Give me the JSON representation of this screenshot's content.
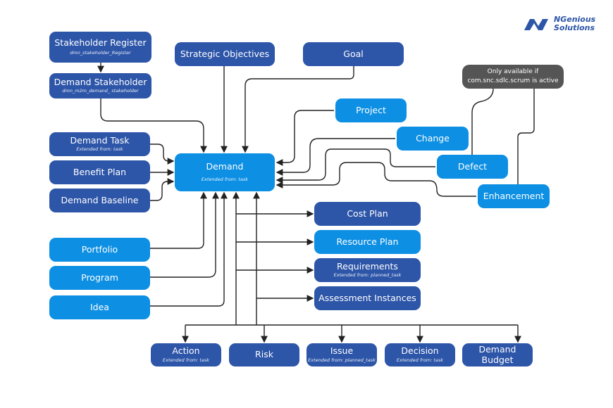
{
  "logo": {
    "line1": "NGenious",
    "line2": "Solutions"
  },
  "note": {
    "text": "Only available if com.snc.sdlc.scrum is active"
  },
  "nodes": {
    "stakeholder_register": {
      "title": "Stakeholder Register",
      "sub": "dmn_stakeholder_Register"
    },
    "demand_stakeholder": {
      "title": "Demand Stakeholder",
      "sub": "dmn_m2m_demand_ stakeholder"
    },
    "strategic_objectives": {
      "title": "Strategic Objectives"
    },
    "goal": {
      "title": "Goal"
    },
    "project": {
      "title": "Project"
    },
    "change": {
      "title": "Change"
    },
    "defect": {
      "title": "Defect"
    },
    "enhancement": {
      "title": "Enhancement"
    },
    "demand_task": {
      "title": "Demand Task",
      "sub": "Extended from: task"
    },
    "benefit_plan": {
      "title": "Benefit Plan"
    },
    "demand_baseline": {
      "title": "Demand Baseline"
    },
    "demand": {
      "title": "Demand",
      "sub": "Extended from: task"
    },
    "cost_plan": {
      "title": "Cost Plan"
    },
    "resource_plan": {
      "title": "Resource Plan"
    },
    "requirements": {
      "title": "Requirements",
      "sub": "Extended from: planned_task"
    },
    "assessment_instances": {
      "title": "Assessment Instances"
    },
    "portfolio": {
      "title": "Portfolio"
    },
    "program": {
      "title": "Program"
    },
    "idea": {
      "title": "Idea"
    },
    "action": {
      "title": "Action",
      "sub": "Extended from: task"
    },
    "risk": {
      "title": "Risk"
    },
    "issue": {
      "title": "Issue",
      "sub": "Extended from: planned_task"
    },
    "decision": {
      "title": "Decision",
      "sub": "Extended from: task"
    },
    "demand_budget": {
      "title": "Demand Budget"
    }
  },
  "colors": {
    "dark": "#2d55a8",
    "light": "#0d8fe3",
    "note": "#555555",
    "line": "#222222"
  }
}
